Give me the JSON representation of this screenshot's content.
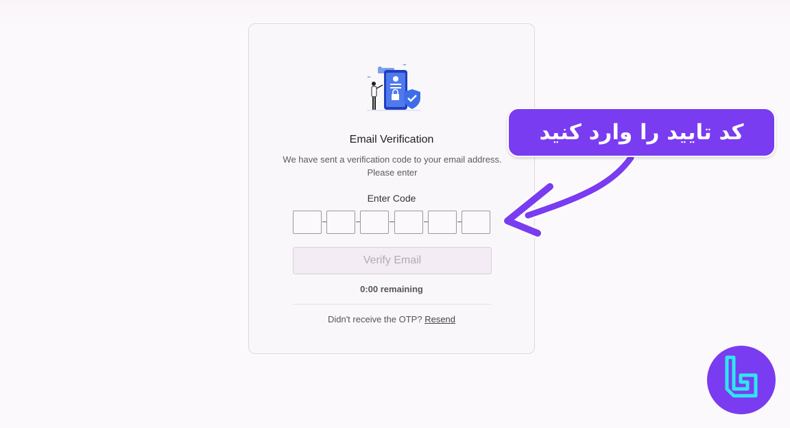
{
  "card": {
    "title": "Email Verification",
    "description": "We have sent a verification code to your email address. Please enter",
    "code_label": "Enter Code",
    "otp_digits": [
      "",
      "",
      "",
      "",
      "",
      ""
    ],
    "verify_button": "Verify Email",
    "timer": "0:00 remaining",
    "resend_prompt": "Didn't receive the OTP?",
    "resend_link": "Resend"
  },
  "annotation": {
    "callout_text": "کد تایید را وارد کنید"
  },
  "colors": {
    "callout": "#7a3cf0",
    "logo_ring": "#7a3cf0",
    "logo_mark": "#2ee6f0"
  }
}
